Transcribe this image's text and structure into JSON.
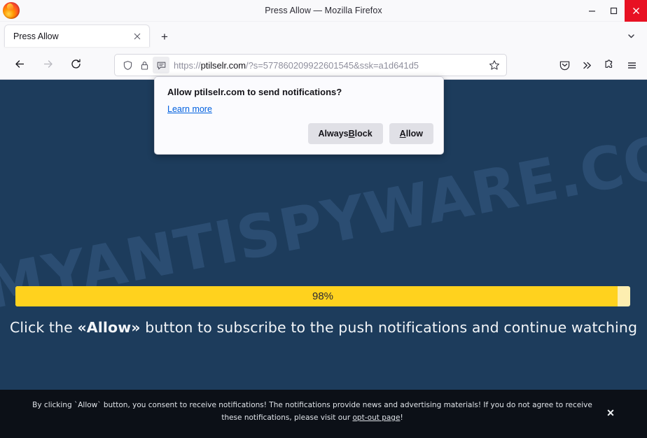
{
  "window": {
    "title": "Press Allow — Mozilla Firefox",
    "minimize_label": "Minimize",
    "maximize_label": "Maximize",
    "close_label": "Close"
  },
  "tabs": {
    "items": [
      {
        "label": "Press Allow",
        "close_label": "×"
      }
    ],
    "new_tab_label": "+",
    "list_all_label": "List all tabs"
  },
  "nav": {
    "back_label": "Back",
    "forward_label": "Forward",
    "reload_label": "Reload"
  },
  "urlbar": {
    "url_scheme": "https://",
    "url_host": "ptilselr.com",
    "url_path": "/?s=577860209922601545&ssk=a1d641d5",
    "url_full": "https://ptilselr.com/?s=577860209922601545&ssk=a1d641d5",
    "shield_label": "Tracking protection",
    "lock_label": "Connection secure",
    "notification_label": "Site notification permission",
    "bookmark_label": "Bookmark this page"
  },
  "toolbar_right": {
    "pocket_label": "Save to Pocket",
    "overflow_label": "More tools",
    "extensions_label": "Extensions",
    "menu_label": "Open application menu"
  },
  "doorhanger": {
    "title": "Allow ptilselr.com to send notifications?",
    "learn_more": "Learn more",
    "always_block_pre": "Always ",
    "always_block_key": "B",
    "always_block_post": "lock",
    "allow_key": "A",
    "allow_post": "llow"
  },
  "page": {
    "background_color": "#1d3c5c",
    "watermark": "MYANTISPYWARE.COM",
    "progress": {
      "percent": 98,
      "label": "98%",
      "fill_color": "#ffd21e",
      "track_color": "#fdeeb0"
    },
    "headline_pre": "Click the ",
    "headline_bold": "«Allow»",
    "headline_post": " button to subscribe to the push notifications and continue watching"
  },
  "banner": {
    "text_part1": "By clicking `Allow` button, you consent to receive notifications! The notifications provide news and advertising materials! If you do not agree to receive these notifications, please visit our ",
    "link": "opt-out page",
    "text_part2": "!",
    "close_label": "✕",
    "background_color": "#0c1017"
  }
}
